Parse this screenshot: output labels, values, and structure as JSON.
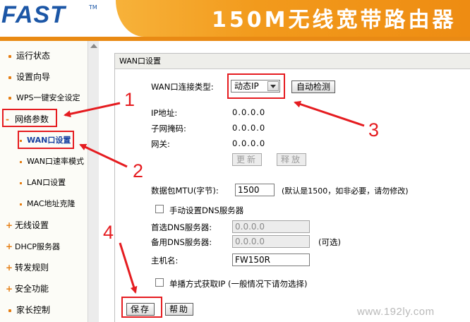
{
  "header": {
    "logo": "FAST",
    "logo_mark": "TM",
    "title": "150M无线宽带路由器"
  },
  "sidebar": {
    "items": [
      {
        "label": "运行状态"
      },
      {
        "label": "设置向导"
      },
      {
        "label": "WPS一键安全设定"
      },
      {
        "label": "网络参数",
        "expander": "-"
      },
      {
        "label": "WAN口设置",
        "selected": true
      },
      {
        "label": "WAN口速率模式"
      },
      {
        "label": "LAN口设置"
      },
      {
        "label": "MAC地址克隆"
      },
      {
        "label": "无线设置",
        "expander": "+"
      },
      {
        "label": "DHCP服务器",
        "expander": "+"
      },
      {
        "label": "转发规则",
        "expander": "+"
      },
      {
        "label": "安全功能",
        "expander": "+"
      },
      {
        "label": "家长控制"
      }
    ]
  },
  "panel": {
    "title": "WAN口设置",
    "conn_type_label": "WAN口连接类型:",
    "conn_type_value": "动态IP",
    "auto_detect_label": "自动检测",
    "ip_label": "IP地址:",
    "ip_value": "0.0.0.0",
    "mask_label": "子网掩码:",
    "mask_value": "0.0.0.0",
    "gateway_label": "网关:",
    "gateway_value": "0.0.0.0",
    "renew_label": "更新",
    "release_label": "释放",
    "mtu_label": "数据包MTU(字节):",
    "mtu_value": "1500",
    "mtu_hint": "(默认是1500，如非必要，请勿修改)",
    "manual_dns_label": "手动设置DNS服务器",
    "primary_dns_label": "首选DNS服务器:",
    "primary_dns_value": "0.0.0.0",
    "secondary_dns_label": "备用DNS服务器:",
    "secondary_dns_value": "0.0.0.0",
    "secondary_dns_hint": "(可选)",
    "hostname_label": "主机名:",
    "hostname_value": "FW150R",
    "unicast_label": "单播方式获取IP  (一般情况下请勿选择)",
    "save_label": "保存",
    "help_label": "帮助"
  },
  "annotations": {
    "numbers": [
      "1",
      "2",
      "3",
      "4"
    ],
    "color": "#e51c20"
  },
  "watermark": "www.192ly.com",
  "colors": {
    "brand_blue": "#1b56a6",
    "header_orange": "#f29a1c",
    "selected_nav": "#1740a0",
    "annotation_red": "#e51c20"
  }
}
